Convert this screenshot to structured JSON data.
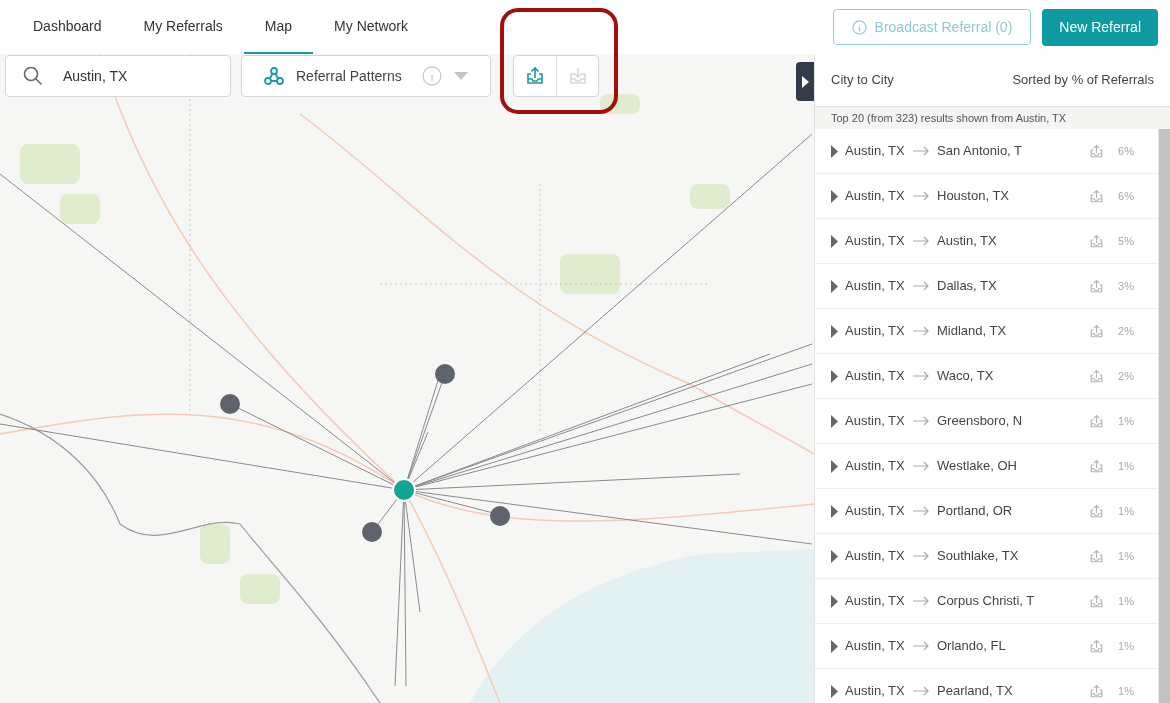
{
  "nav": {
    "tabs": [
      {
        "label": "Dashboard",
        "selected": false
      },
      {
        "label": "My Referrals",
        "selected": false
      },
      {
        "label": "Map",
        "selected": true
      },
      {
        "label": "My Network",
        "selected": false
      }
    ],
    "broadcast": {
      "label": "Broadcast Referral (0)",
      "disabled": true
    },
    "new_referral": {
      "label": "New Referral"
    }
  },
  "map_controls": {
    "search": {
      "value": "Austin, TX"
    },
    "layer_select": {
      "value": "Referral Patterns"
    },
    "transfer_buttons": [
      {
        "kind": "upload",
        "disabled": false
      },
      {
        "kind": "download",
        "disabled": true
      }
    ]
  },
  "panel": {
    "title": "City to City",
    "sort": "Sorted by % of Referrals",
    "summary": "Top 20 (from 323) results shown from Austin, TX",
    "rows": [
      {
        "from": "Austin, TX",
        "to": "San Antonio, T",
        "percent": "6%",
        "expanded": false
      },
      {
        "from": "Austin, TX",
        "to": "Houston, TX",
        "percent": "6%",
        "expanded": false
      },
      {
        "from": "Austin, TX",
        "to": "Austin, TX",
        "percent": "5%",
        "expanded": false
      },
      {
        "from": "Austin, TX",
        "to": "Dallas, TX",
        "percent": "3%",
        "expanded": false
      },
      {
        "from": "Austin, TX",
        "to": "Midland, TX",
        "percent": "2%",
        "expanded": false
      },
      {
        "from": "Austin, TX",
        "to": "Waco, TX",
        "percent": "2%",
        "expanded": false
      },
      {
        "from": "Austin, TX",
        "to": "Greensboro, N",
        "percent": "1%",
        "expanded": false
      },
      {
        "from": "Austin, TX",
        "to": "Westlake, OH",
        "percent": "1%",
        "expanded": false
      },
      {
        "from": "Austin, TX",
        "to": "Portland, OR",
        "percent": "1%",
        "expanded": false
      },
      {
        "from": "Austin, TX",
        "to": "Southlake, TX",
        "percent": "1%",
        "expanded": false
      },
      {
        "from": "Austin, TX",
        "to": "Corpus Christi, T",
        "percent": "1%",
        "expanded": false
      },
      {
        "from": "Austin, TX",
        "to": "Orlando, FL",
        "percent": "1%",
        "expanded": false
      },
      {
        "from": "Austin, TX",
        "to": "Pearland, TX",
        "percent": "1%",
        "expanded": false
      }
    ]
  }
}
